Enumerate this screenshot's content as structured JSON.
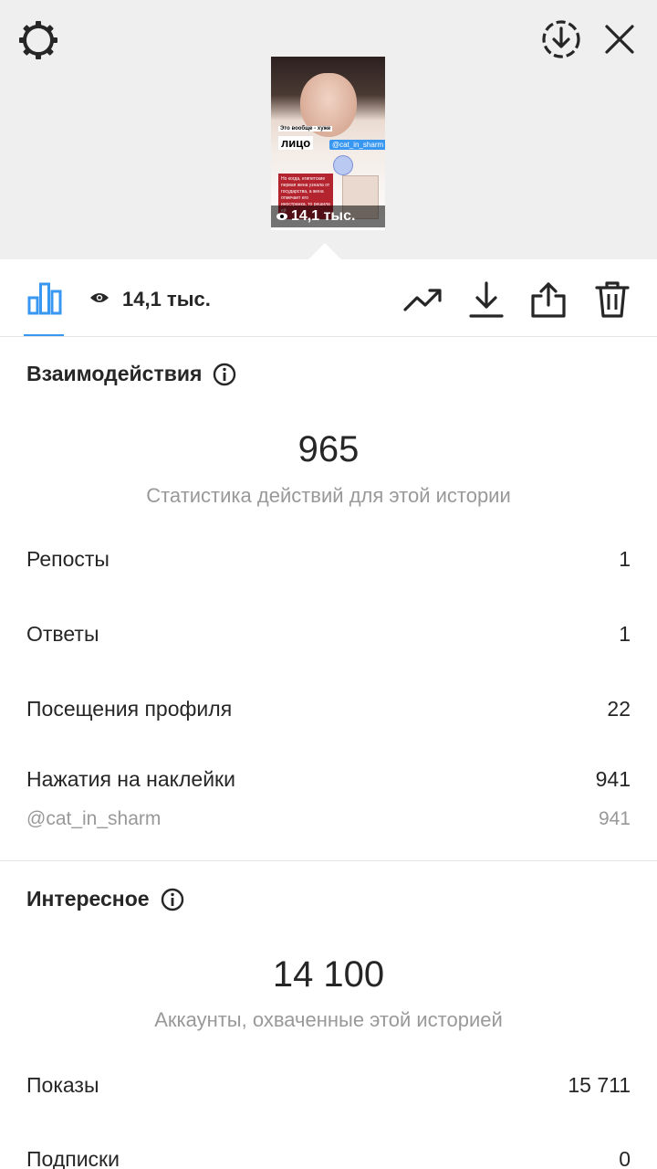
{
  "header": {
    "settings_icon": "settings-gear-icon",
    "download_icon": "download-circle-icon",
    "close_icon": "close-icon"
  },
  "story_preview": {
    "caption_small": "Это вообще - хуже",
    "caption_large": "лицо",
    "mention": "@cat_in_sharm",
    "body_text": "Но когда, египетские первая жена узнала от государства, а жена отмечает его иностранка, то решила ей",
    "views_overlay": "14,1 тыс."
  },
  "toolbar": {
    "views_label": "14,1 тыс.",
    "accent_color": "#3897f0"
  },
  "interactions": {
    "title": "Взаимодействия",
    "total": "965",
    "subtitle": "Статистика действий для этой истории",
    "rows": [
      {
        "label": "Репосты",
        "value": "1"
      },
      {
        "label": "Ответы",
        "value": "1"
      },
      {
        "label": "Посещения профиля",
        "value": "22"
      },
      {
        "label": "Нажатия на наклейки",
        "value": "941"
      }
    ],
    "sticker_detail": {
      "label": "@cat_in_sharm",
      "value": "941"
    }
  },
  "discovery": {
    "title": "Интересное",
    "total": "14 100",
    "subtitle": "Аккаунты, охваченные этой историей",
    "rows": [
      {
        "label": "Показы",
        "value": "15 711"
      },
      {
        "label": "Подписки",
        "value": "0"
      }
    ]
  }
}
